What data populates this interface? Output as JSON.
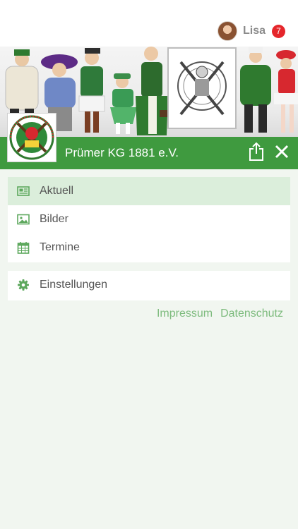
{
  "user": {
    "name": "Lisa",
    "notification_count": "7"
  },
  "club": {
    "title": "Prümer KG 1881 e.V."
  },
  "menu": {
    "items": [
      {
        "label": "Aktuell",
        "icon": "newspaper-icon",
        "active": true
      },
      {
        "label": "Bilder",
        "icon": "image-icon",
        "active": false
      },
      {
        "label": "Termine",
        "icon": "calendar-icon",
        "active": false
      }
    ],
    "settings": {
      "label": "Einstellungen",
      "icon": "gear-icon"
    }
  },
  "footer": {
    "impressum": "Impressum",
    "datenschutz": "Datenschutz"
  },
  "colors": {
    "header_green": "#3f9a3f",
    "active_item_bg": "#dbeedb",
    "icon_green": "#5da85d",
    "link_green": "#7dbb7d",
    "badge_red": "#e5262b",
    "page_bg": "#f1f6f0"
  }
}
